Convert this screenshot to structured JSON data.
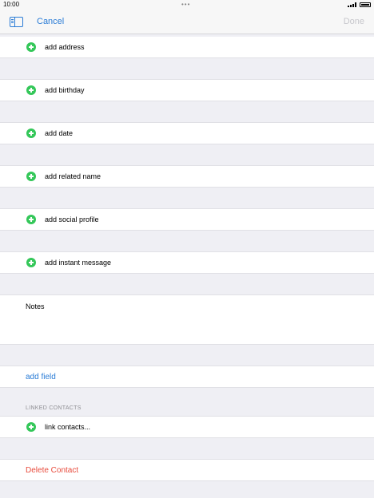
{
  "status_bar": {
    "time": "10:00",
    "dots": "•••"
  },
  "nav": {
    "cancel_label": "Cancel",
    "done_label": "Done"
  },
  "rows": [
    {
      "label": "add address"
    },
    {
      "label": "add birthday"
    },
    {
      "label": "add date"
    },
    {
      "label": "add related name"
    },
    {
      "label": "add social profile"
    },
    {
      "label": "add instant message"
    }
  ],
  "notes": {
    "label": "Notes"
  },
  "add_field": {
    "label": "add field"
  },
  "linked_contacts": {
    "header": "LINKED CONTACTS",
    "link_label": "link contacts..."
  },
  "delete_contact": {
    "label": "Delete Contact"
  },
  "colors": {
    "accent": "#2a7cd6",
    "add_green": "#34c759",
    "destructive": "#e84b3c",
    "background": "#efeff4"
  }
}
